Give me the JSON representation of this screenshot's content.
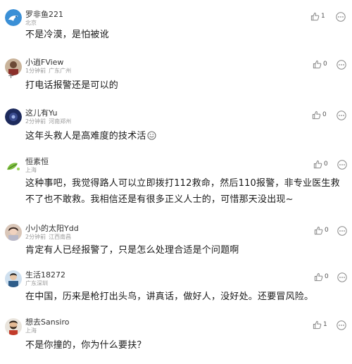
{
  "comments": [
    {
      "user": "罗非鱼221",
      "time": "",
      "location": "北京",
      "content": "不是冷漠，是怕被讹",
      "likes": "1",
      "avatar_icon": "blue-bird-avatar-icon"
    },
    {
      "user": "小逍FView",
      "time": "1分钟前",
      "location": "广东广州",
      "content": "打电话报警还是可以的",
      "likes": "0",
      "avatar_icon": "person-photo-avatar-icon"
    },
    {
      "user": "这儿有Yu",
      "time": "2分钟前",
      "location": "河南郑州",
      "content": "这年头救人是高难度的技术活",
      "likes": "0",
      "avatar_icon": "dark-blue-avatar-icon"
    },
    {
      "user": "恒素恒",
      "time": "",
      "location": "上海",
      "content": "这种事吧，我觉得路人可以立即拨打112救命，然后110报警，非专业医生救不了也不敢救。我相信还是有很多正义人士的，可惜那天没出现~",
      "likes": "0",
      "avatar_icon": "green-leaf-avatar-icon"
    },
    {
      "user": "小小的太阳Ydd",
      "time": "2分钟前",
      "location": "江西南昌",
      "content": "肯定有人已经报警了，只是怎么处理合适是个问题啊",
      "likes": "0",
      "avatar_icon": "girl-photo-avatar-icon"
    },
    {
      "user": "生活18272",
      "time": "",
      "location": "广东深圳",
      "content": "在中国，历来是枪打出头鸟，讲真话，做好人，没好处。还要冒风险。",
      "likes": "0",
      "avatar_icon": "man-photo-avatar-icon"
    },
    {
      "user": "想去Sansiro",
      "time": "",
      "location": "上海",
      "content": "不是你撞的，你为什么要扶？",
      "likes": "1",
      "avatar_icon": "bearded-man-avatar-icon"
    }
  ],
  "colors": {
    "username": "#333333",
    "meta": "#9a9a9a",
    "content": "#1a1a1a",
    "icon": "#888888"
  }
}
